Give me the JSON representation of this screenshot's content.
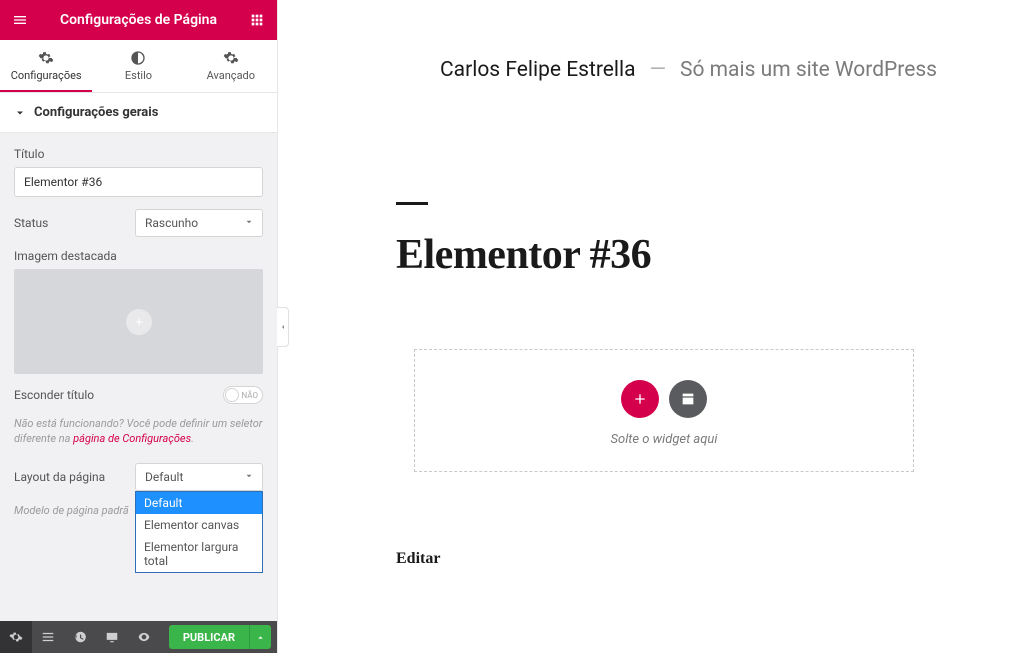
{
  "header": {
    "title": "Configurações de Página"
  },
  "tabs": [
    {
      "label": "Configurações",
      "active": true
    },
    {
      "label": "Estilo",
      "active": false
    },
    {
      "label": "Avançado",
      "active": false
    }
  ],
  "section_title": "Configurações gerais",
  "controls": {
    "title_label": "Título",
    "title_value": "Elementor #36",
    "status_label": "Status",
    "status_value": "Rascunho",
    "featured_image_label": "Imagem destacada",
    "hide_title_label": "Esconder título",
    "hide_title_toggle": "NÃO",
    "hint_prefix": "Não está funcionando? Você pode definir um seletor diferente na ",
    "hint_link": "página de Configurações",
    "hint_suffix": ".",
    "layout_label": "Layout da página",
    "layout_value": "Default",
    "layout_options": [
      "Default",
      "Elementor canvas",
      "Elementor largura total"
    ],
    "template_hint": "Modelo de página padrã"
  },
  "footer": {
    "publish": "PUBLICAR"
  },
  "canvas": {
    "site_title": "Carlos Felipe Estrella",
    "separator": "—",
    "tagline": "Só mais um site WordPress",
    "page_heading": "Elementor #36",
    "dropzone_text": "Solte o widget aqui",
    "edit_link": "Editar"
  }
}
